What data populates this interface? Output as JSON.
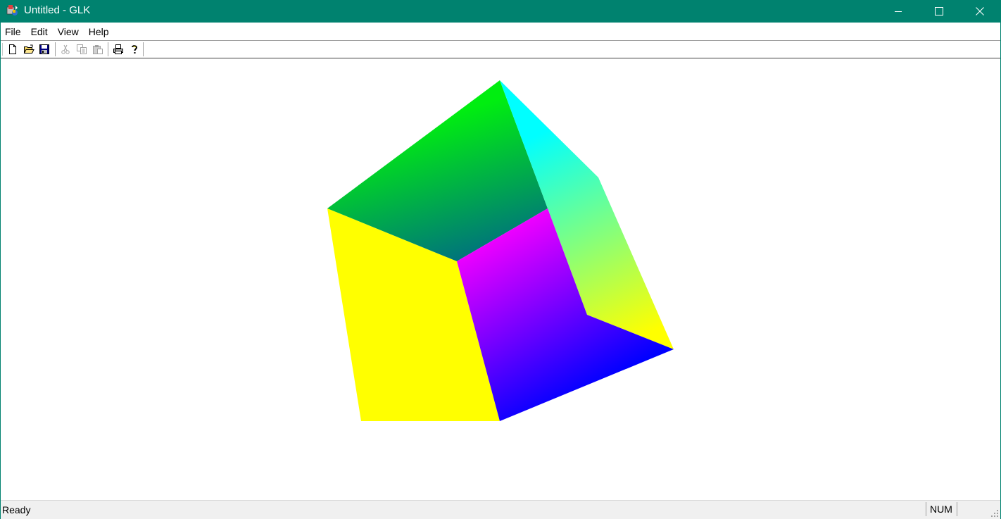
{
  "window": {
    "title": "Untitled - GLK",
    "title_bar_color": "#00826f",
    "app_icon": "mfc-app-icon",
    "controls": [
      "minimize-icon",
      "maximize-icon",
      "close-icon"
    ]
  },
  "menu": {
    "items": [
      {
        "label": "File"
      },
      {
        "label": "Edit"
      },
      {
        "label": "View"
      },
      {
        "label": "Help"
      }
    ]
  },
  "toolbar": {
    "buttons": [
      {
        "icon": "new-document-icon",
        "enabled": true
      },
      {
        "icon": "open-folder-icon",
        "enabled": true
      },
      {
        "icon": "save-disk-icon",
        "enabled": true
      },
      {
        "icon": "cut-scissors-icon",
        "enabled": false
      },
      {
        "icon": "copy-icon",
        "enabled": false
      },
      {
        "icon": "paste-icon",
        "enabled": false
      },
      {
        "icon": "print-icon",
        "enabled": true
      },
      {
        "icon": "help-question-icon",
        "enabled": true
      }
    ]
  },
  "scene": {
    "object": "rgb-color-cube",
    "colors": {
      "yellow": "#ffff00",
      "green": "#00ff00",
      "cyan": "#00ffff",
      "magenta": "#ff00ff",
      "blue": "#0000ff",
      "teal": "#007f7f"
    }
  },
  "status": {
    "text": "Ready",
    "num_indicator": "NUM",
    "scroll_indicator": ""
  }
}
